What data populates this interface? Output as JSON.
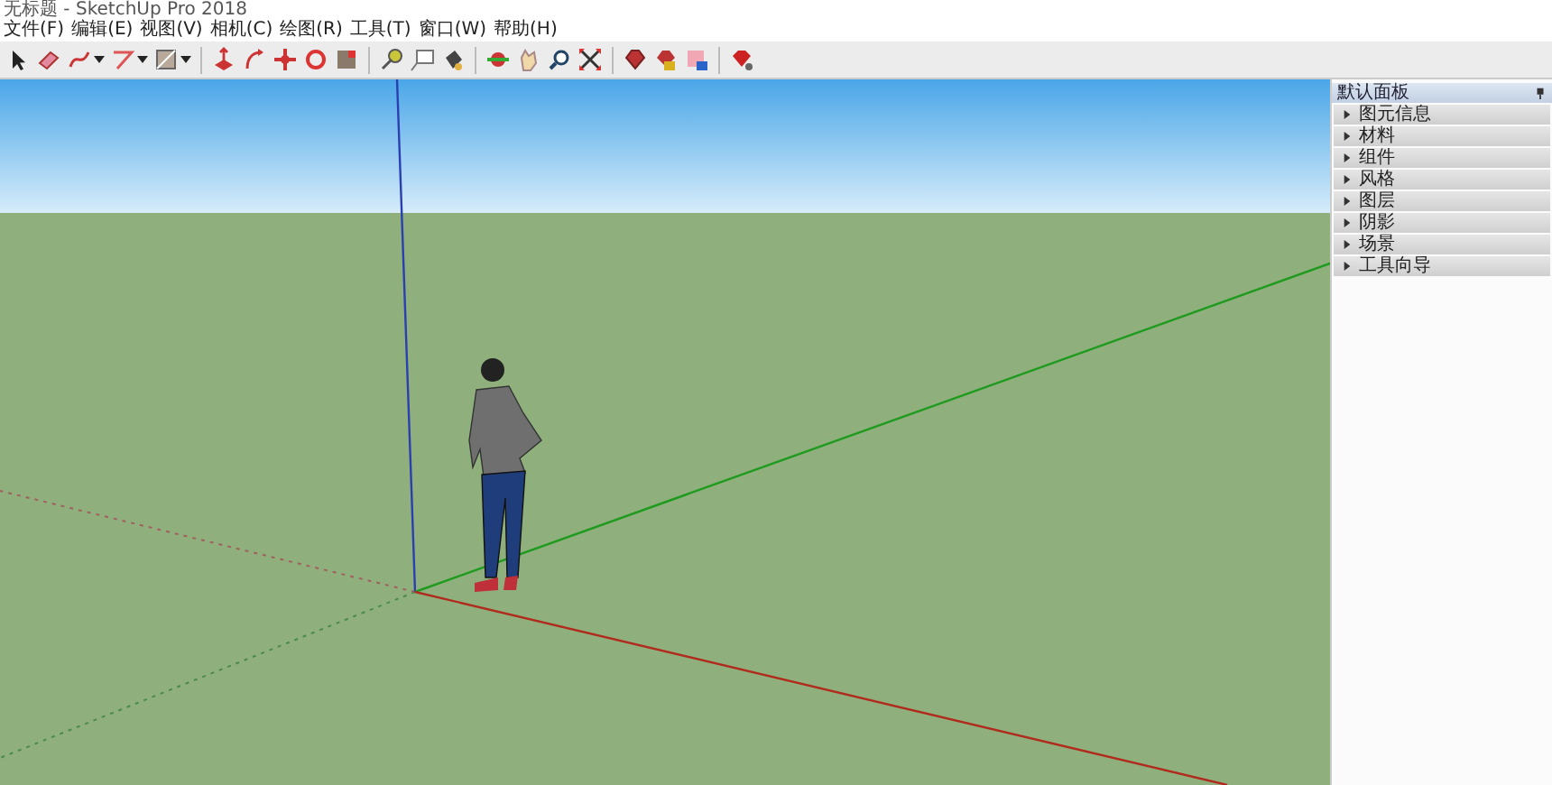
{
  "window": {
    "title": "无标题 - SketchUp Pro 2018"
  },
  "menu": [
    "文件(F)",
    "编辑(E)",
    "视图(V)",
    "相机(C)",
    "绘图(R)",
    "工具(T)",
    "窗口(W)",
    "帮助(H)"
  ],
  "tray": {
    "title": "默认面板",
    "panels": [
      {
        "label": "图元信息",
        "expanded": false
      },
      {
        "label": "材料",
        "expanded": false
      },
      {
        "label": "组件",
        "expanded": false
      },
      {
        "label": "风格",
        "expanded": false
      },
      {
        "label": "图层",
        "expanded": false
      },
      {
        "label": "阴影",
        "expanded": false
      },
      {
        "label": "场景",
        "expanded": false
      },
      {
        "label": "工具向导",
        "expanded": false
      }
    ]
  }
}
